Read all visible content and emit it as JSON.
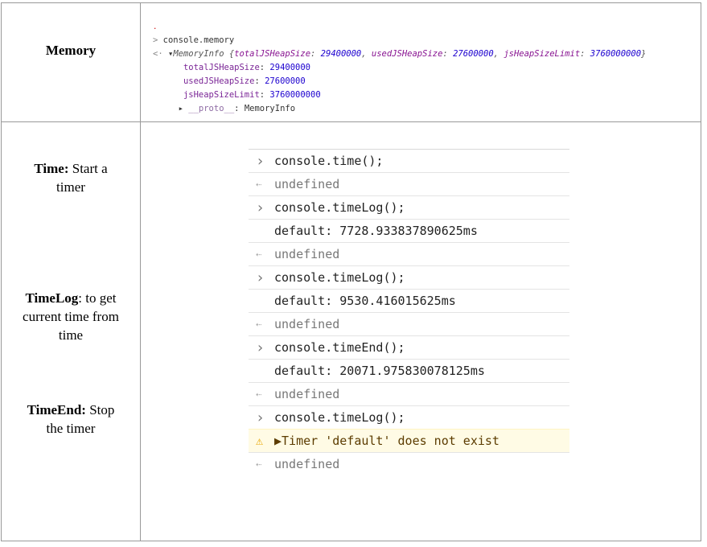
{
  "labels": {
    "memory": "Memory",
    "time_bold": "Time:",
    "time_rest1": " Start a",
    "time_rest2": "timer",
    "timelog_bold": "TimeLog",
    "timelog_rest1": ": to get",
    "timelog_rest2": "current time from",
    "timelog_rest3": "time",
    "timeend_bold": "TimeEnd:",
    "timeend_rest1": " Stop",
    "timeend_rest2": "the timer"
  },
  "memory_console": {
    "command": "console.memory",
    "summary_type": "MemoryInfo",
    "summary_open": " {",
    "summary_k1": "totalJSHeapSize",
    "summary_v1": "29400000",
    "summary_k2": "usedJSHeapSize",
    "summary_v2": "27600000",
    "summary_k3": "jsHeapSizeLimit",
    "summary_v3": "3760000000",
    "summary_close": "}",
    "props": [
      {
        "key": "totalJSHeapSize",
        "value": "29400000"
      },
      {
        "key": "usedJSHeapSize",
        "value": "27600000"
      },
      {
        "key": "jsHeapSizeLimit",
        "value": "3760000000"
      }
    ],
    "proto_key": "__proto__",
    "proto_value": "MemoryInfo"
  },
  "time_console": {
    "rows": [
      {
        "kind": "input",
        "text": "console.time();"
      },
      {
        "kind": "result",
        "text": "undefined"
      },
      {
        "kind": "input",
        "text": "console.timeLog();"
      },
      {
        "kind": "output",
        "text": "default: 7728.933837890625ms"
      },
      {
        "kind": "result",
        "text": "undefined"
      },
      {
        "kind": "input",
        "text": "console.timeLog();"
      },
      {
        "kind": "output",
        "text": "default: 9530.416015625ms"
      },
      {
        "kind": "result",
        "text": "undefined"
      },
      {
        "kind": "input",
        "text": "console.timeEnd();"
      },
      {
        "kind": "output",
        "text": "default: 20071.975830078125ms"
      },
      {
        "kind": "result",
        "text": "undefined"
      },
      {
        "kind": "input",
        "text": "console.timeLog();"
      },
      {
        "kind": "warning",
        "text": "▶Timer 'default' does not exist"
      },
      {
        "kind": "result",
        "text": "undefined"
      }
    ]
  },
  "icons": {
    "input": "chevron-right-icon",
    "result": "return-arrow-icon",
    "warning": "warning-icon"
  }
}
